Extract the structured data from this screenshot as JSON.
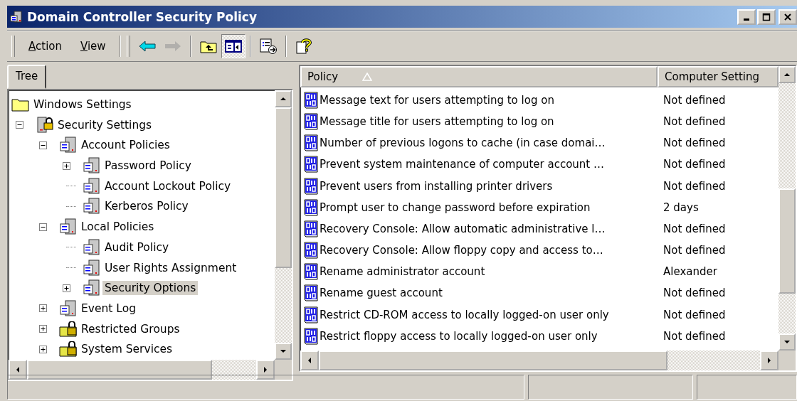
{
  "window": {
    "title": "Domain Controller Security Policy"
  },
  "menu": [
    {
      "label": "Action"
    },
    {
      "label": "View"
    }
  ],
  "toolbar": [
    {
      "kind": "back",
      "disabled": false,
      "pressed": false
    },
    {
      "kind": "forward",
      "disabled": true,
      "pressed": false
    },
    {
      "kind": "up",
      "disabled": false,
      "pressed": false
    },
    {
      "kind": "tree-toggle",
      "disabled": false,
      "pressed": true
    },
    {
      "kind": "export",
      "disabled": false,
      "pressed": false
    },
    {
      "kind": "help",
      "disabled": false,
      "pressed": false
    }
  ],
  "tabs": [
    {
      "label": "Tree",
      "selected": true
    }
  ],
  "tree": [
    {
      "label": "Windows Settings",
      "kind": "folder",
      "selected": false,
      "children": [
        {
          "label": "Security Settings",
          "kind": "lock-server",
          "expanded": true,
          "selected": false,
          "children": [
            {
              "label": "Account Policies",
              "kind": "server",
              "expanded": true,
              "selected": false,
              "children": [
                {
                  "label": "Password Policy",
                  "kind": "server",
                  "expanded": false,
                  "selected": false
                },
                {
                  "label": "Account Lockout Policy",
                  "kind": "server",
                  "selected": false
                },
                {
                  "label": "Kerberos Policy",
                  "kind": "server",
                  "selected": false
                }
              ]
            },
            {
              "label": "Local Policies",
              "kind": "server",
              "expanded": true,
              "selected": false,
              "children": [
                {
                  "label": "Audit Policy",
                  "kind": "server",
                  "selected": false
                },
                {
                  "label": "User Rights Assignment",
                  "kind": "server",
                  "selected": false
                },
                {
                  "label": "Security Options",
                  "kind": "server",
                  "expanded": false,
                  "selected": true
                }
              ]
            },
            {
              "label": "Event Log",
              "kind": "server",
              "expanded": false,
              "selected": false
            },
            {
              "label": "Restricted Groups",
              "kind": "lock-folder",
              "expanded": false,
              "selected": false
            },
            {
              "label": "System Services",
              "kind": "lock-folder",
              "expanded": false,
              "selected": false
            }
          ]
        }
      ]
    }
  ],
  "table": {
    "columns": [
      "Policy",
      "Computer Setting"
    ],
    "rows": [
      [
        "Message text for users attempting to log on",
        "Not defined"
      ],
      [
        "Message title for users attempting to log on",
        "Not defined"
      ],
      [
        "Number of previous logons to cache (in case domai…",
        "Not defined"
      ],
      [
        "Prevent system maintenance of computer account …",
        "Not defined"
      ],
      [
        "Prevent users from installing printer drivers",
        "Not defined"
      ],
      [
        "Prompt user to change password before expiration",
        "2 days"
      ],
      [
        "Recovery Console: Allow automatic administrative l…",
        "Not defined"
      ],
      [
        "Recovery Console: Allow floppy copy and access to…",
        "Not defined"
      ],
      [
        "Rename administrator account",
        "Alexander"
      ],
      [
        "Rename guest account",
        "Not defined"
      ],
      [
        "Restrict CD-ROM access to locally logged-on user only",
        "Not defined"
      ],
      [
        "Restrict floppy access to locally logged-on user only",
        "Not defined"
      ]
    ]
  }
}
